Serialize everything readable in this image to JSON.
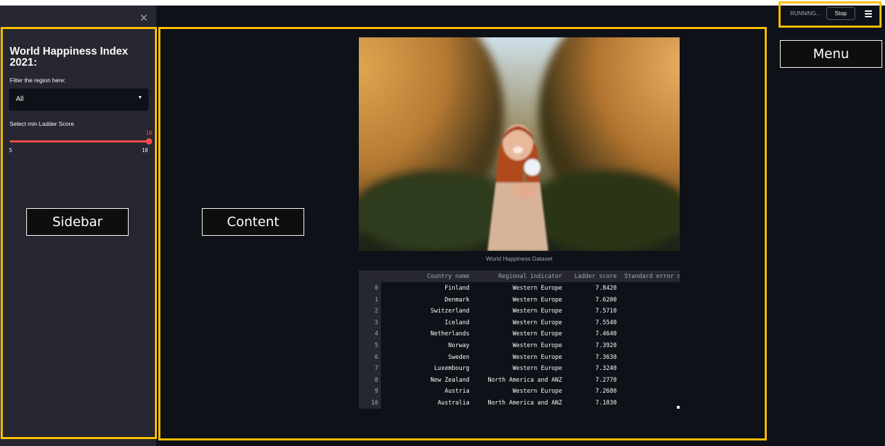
{
  "sidebar": {
    "title": "World Happiness Index 2021:",
    "region_label": "Filter the region here:",
    "region_selected": "All",
    "slider_label": "Select min Ladder Score",
    "slider_value": "10",
    "slider_min": "5",
    "slider_max": "10",
    "slider_fraction": 1.0
  },
  "header": {
    "status": "RUNNING...",
    "stop_label": "Stop"
  },
  "main": {
    "image_caption": "World Happiness Dataset",
    "table": {
      "columns": [
        "Country name",
        "Regional indicator",
        "Ladder score",
        "Standard error o"
      ],
      "rows": [
        {
          "idx": "0",
          "country": "Finland",
          "region": "Western Europe",
          "score": "7.8420"
        },
        {
          "idx": "1",
          "country": "Denmark",
          "region": "Western Europe",
          "score": "7.6200"
        },
        {
          "idx": "2",
          "country": "Switzerland",
          "region": "Western Europe",
          "score": "7.5710"
        },
        {
          "idx": "3",
          "country": "Iceland",
          "region": "Western Europe",
          "score": "7.5540"
        },
        {
          "idx": "4",
          "country": "Netherlands",
          "region": "Western Europe",
          "score": "7.4640"
        },
        {
          "idx": "5",
          "country": "Norway",
          "region": "Western Europe",
          "score": "7.3920"
        },
        {
          "idx": "6",
          "country": "Sweden",
          "region": "Western Europe",
          "score": "7.3630"
        },
        {
          "idx": "7",
          "country": "Luxembourg",
          "region": "Western Europe",
          "score": "7.3240"
        },
        {
          "idx": "8",
          "country": "New Zealand",
          "region": "North America and ANZ",
          "score": "7.2770"
        },
        {
          "idx": "9",
          "country": "Austria",
          "region": "Western Europe",
          "score": "7.2680"
        },
        {
          "idx": "10",
          "country": "Australia",
          "region": "North America and ANZ",
          "score": "7.1830"
        }
      ]
    }
  },
  "annotations": {
    "sidebar": "Sidebar",
    "content": "Content",
    "menu": "Menu"
  },
  "colors": {
    "accent": "#ff4b4b",
    "highlight": "#ffc000",
    "background": "#0e1117",
    "sidebar_bg": "#262730"
  },
  "icons": {
    "close": "close-icon",
    "menu": "hamburger-menu-icon",
    "caret": "caret-down-icon"
  }
}
